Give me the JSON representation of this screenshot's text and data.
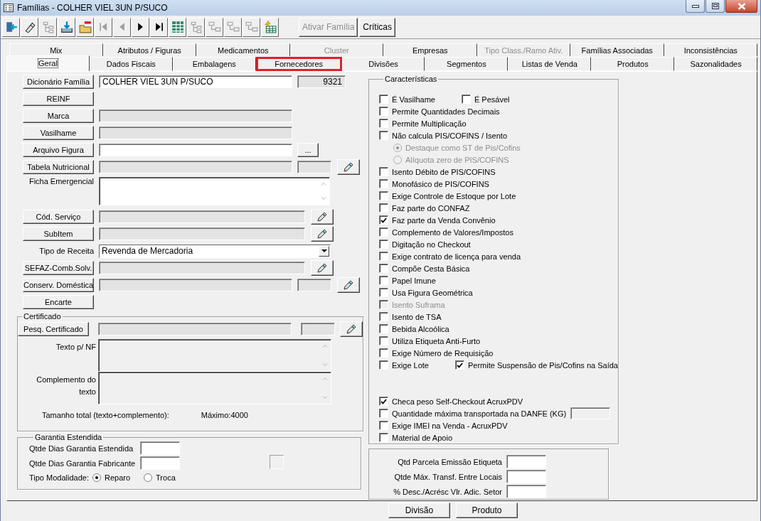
{
  "window": {
    "title": "Famílias - COLHER VIEL 3UN P/SUCO"
  },
  "toolbar": {
    "icons": [
      {
        "kind": "exit",
        "disabled": false
      },
      {
        "kind": "eraser",
        "disabled": false
      },
      {
        "kind": "tree",
        "disabled": true
      },
      {
        "kind": "import",
        "disabled": false
      },
      {
        "kind": "folder-remove",
        "disabled": false
      },
      {
        "kind": "first",
        "disabled": true
      },
      {
        "kind": "prev",
        "disabled": true
      },
      {
        "kind": "next",
        "disabled": false
      },
      {
        "kind": "last",
        "disabled": false
      },
      {
        "kind": "grid",
        "disabled": false
      },
      {
        "kind": "tree",
        "disabled": true
      },
      {
        "kind": "flow",
        "disabled": true
      },
      {
        "kind": "flow",
        "disabled": true
      },
      {
        "kind": "flow",
        "disabled": true
      },
      {
        "kind": "bolt-grid",
        "disabled": false
      }
    ],
    "buttons": [
      {
        "label": "Ativar Família",
        "disabled": true
      },
      {
        "label": "Críticas",
        "disabled": false
      }
    ]
  },
  "tabs_back": [
    {
      "label": "Mix",
      "disabled": false
    },
    {
      "label": "Atributos / Figuras",
      "disabled": false
    },
    {
      "label": "Medicamentos",
      "disabled": false
    },
    {
      "label": "Cluster",
      "disabled": true
    },
    {
      "label": "Empresas",
      "disabled": false
    },
    {
      "label": "Tipo Class./Ramo Ativ.",
      "disabled": true
    },
    {
      "label": "Famílias Associadas",
      "disabled": false
    },
    {
      "label": "Inconsistências",
      "disabled": false
    }
  ],
  "tabs_front": [
    {
      "label": "Geral",
      "selected": true,
      "highlighted": false
    },
    {
      "label": "Dados Fiscais",
      "selected": false,
      "highlighted": false
    },
    {
      "label": "Embalagens",
      "selected": false,
      "highlighted": false
    },
    {
      "label": "Fornecedores",
      "selected": false,
      "highlighted": true
    },
    {
      "label": "Divisões",
      "selected": false,
      "highlighted": false
    },
    {
      "label": "Segmentos",
      "selected": false,
      "highlighted": false
    },
    {
      "label": "Listas de Venda",
      "selected": false,
      "highlighted": false
    },
    {
      "label": "Produtos",
      "selected": false,
      "highlighted": false
    },
    {
      "label": "Sazonalidades",
      "selected": false,
      "highlighted": false
    }
  ],
  "general_rows": [
    {
      "kind": "lookup",
      "button": "Dicionário Família",
      "fields": [
        {
          "value": "COLHER VIEL 3UN P/SUCO",
          "editable": true
        },
        {
          "value": "9321",
          "editable": false
        }
      ]
    },
    {
      "kind": "button",
      "button": "REINF"
    },
    {
      "kind": "lookup",
      "button": "Marca",
      "fields": [
        {
          "editable": false
        }
      ]
    },
    {
      "kind": "lookup",
      "button": "Vasilhame",
      "fields": [
        {
          "editable": false
        }
      ]
    },
    {
      "kind": "lookup",
      "button": "Arquivo Figura",
      "fields": [
        {
          "editable": true
        }
      ],
      "action": {
        "kind": "browse",
        "label": "..."
      }
    },
    {
      "kind": "lookup",
      "button": "Tabela Nutricional",
      "fields": [
        {
          "editable": false
        },
        {
          "editable": false
        }
      ],
      "action": {
        "kind": "edit"
      }
    },
    {
      "kind": "memo",
      "label": "Ficha Emergencial",
      "editable": true
    },
    {
      "kind": "lookup",
      "button": "Cód. Serviço",
      "fields": [
        {
          "editable": false
        }
      ],
      "action": {
        "kind": "edit"
      }
    },
    {
      "kind": "lookup",
      "button": "SubItem",
      "fields": [
        {
          "editable": false
        }
      ],
      "action": {
        "kind": "edit"
      }
    },
    {
      "kind": "select",
      "label": "Tipo de Receita",
      "value": "Revenda de Mercadoria"
    },
    {
      "kind": "lookup",
      "button": "SEFAZ-Comb.Solv.",
      "fields": [
        {
          "editable": false
        }
      ],
      "action": {
        "kind": "edit"
      }
    },
    {
      "kind": "lookup",
      "button": "Conserv. Doméstica",
      "fields": [
        {
          "editable": false
        },
        {
          "editable": false
        }
      ],
      "action": {
        "kind": "edit"
      }
    },
    {
      "kind": "button",
      "button": "Encarte"
    }
  ],
  "certificate": {
    "title": "Certificado",
    "lookup": {
      "kind": "lookup",
      "button": "Pesq. Certificado",
      "fields": [
        {
          "editable": false
        },
        {
          "editable": false
        }
      ],
      "action": {
        "kind": "edit"
      }
    },
    "memos": [
      {
        "label": "Texto p/ NF",
        "editable": false
      },
      {
        "label": "Complemento do texto",
        "editable": false
      }
    ],
    "total_label": "Tamanho total (texto+complemento):",
    "max_label": "Máximo:4000"
  },
  "warranty": {
    "title": "Garantia Estendida",
    "fields": [
      {
        "label": "Qtde Dias Garantia Estendida"
      },
      {
        "label": "Qtde Dias Garantia Fabricante"
      }
    ],
    "modality": {
      "label": "Tipo Modalidade:",
      "options": [
        {
          "label": "Reparo",
          "selected": true
        },
        {
          "label": "Troca",
          "selected": false
        }
      ]
    }
  },
  "characteristics": {
    "title": "Características",
    "blocks": [
      {
        "rows": [
          {
            "items": [
              {
                "kind": "check",
                "label": "É Vasilhame",
                "checked": false,
                "disabled": false
              },
              {
                "kind": "check",
                "label": "É Pesável",
                "checked": false,
                "disabled": false
              }
            ]
          },
          {
            "items": [
              {
                "kind": "check",
                "label": "Permite Quantidades Decimais",
                "checked": false,
                "disabled": false
              }
            ]
          },
          {
            "items": [
              {
                "kind": "check",
                "label": "Permite Multiplicação",
                "checked": false,
                "disabled": false
              }
            ]
          },
          {
            "items": [
              {
                "kind": "check",
                "label": "Não calcula PIS/COFINS / Isento",
                "checked": false,
                "disabled": false
              }
            ]
          },
          {
            "items": [
              {
                "kind": "radio",
                "label": "Destaque como ST de Pis/Cofins",
                "selected": true,
                "disabled": true
              }
            ]
          },
          {
            "items": [
              {
                "kind": "radio",
                "label": "Alíquota zero de PIS/COFINS",
                "selected": false,
                "disabled": true
              }
            ]
          },
          {
            "items": [
              {
                "kind": "check",
                "label": "Isento Débito de PIS/COFINS",
                "checked": false,
                "disabled": false
              }
            ]
          },
          {
            "items": [
              {
                "kind": "check",
                "label": "Monofásico de PIS/COFINS",
                "checked": false,
                "disabled": false
              }
            ]
          },
          {
            "items": [
              {
                "kind": "check",
                "label": "Exige Controle de Estoque por Lote",
                "checked": false,
                "disabled": false
              }
            ]
          },
          {
            "items": [
              {
                "kind": "check",
                "label": "Faz parte do CONFAZ",
                "checked": false,
                "disabled": false
              }
            ]
          },
          {
            "items": [
              {
                "kind": "check",
                "label": "Faz parte da Venda Convênio",
                "checked": true,
                "disabled": false
              }
            ]
          },
          {
            "items": [
              {
                "kind": "check",
                "label": "Complemento de Valores/Impostos",
                "checked": false,
                "disabled": false
              }
            ]
          },
          {
            "items": [
              {
                "kind": "check",
                "label": "Digitação no Checkout",
                "checked": false,
                "disabled": false
              }
            ]
          },
          {
            "items": [
              {
                "kind": "check",
                "label": "Exige contrato de licença para venda",
                "checked": false,
                "disabled": false
              }
            ]
          },
          {
            "items": [
              {
                "kind": "check",
                "label": "Compõe Cesta Básica",
                "checked": false,
                "disabled": false
              }
            ]
          },
          {
            "items": [
              {
                "kind": "check",
                "label": "Papel Imune",
                "checked": false,
                "disabled": false
              }
            ]
          },
          {
            "items": [
              {
                "kind": "check",
                "label": "Usa Figura Geométrica",
                "checked": false,
                "disabled": false
              }
            ]
          },
          {
            "items": [
              {
                "kind": "check",
                "label": "Isento Suframa",
                "checked": false,
                "disabled": true
              }
            ]
          },
          {
            "items": [
              {
                "kind": "check",
                "label": "Isento de TSA",
                "checked": false,
                "disabled": false
              }
            ]
          },
          {
            "items": [
              {
                "kind": "check",
                "label": "Bebida Alcoólica",
                "checked": false,
                "disabled": false
              }
            ]
          },
          {
            "items": [
              {
                "kind": "check",
                "label": "Utiliza Etiqueta Anti-Furto",
                "checked": false,
                "disabled": false
              }
            ]
          },
          {
            "items": [
              {
                "kind": "check",
                "label": "Exige Número de Requisição",
                "checked": false,
                "disabled": false
              }
            ]
          },
          {
            "items": [
              {
                "kind": "check",
                "label": "Exige Lote",
                "checked": false,
                "disabled": false
              },
              {
                "kind": "check",
                "label": "Permite Suspensão de Pis/Cofins na Saída",
                "checked": true,
                "disabled": false
              }
            ]
          }
        ]
      },
      {
        "rows": [
          {
            "items": [
              {
                "kind": "check",
                "label": "Checa peso Self-Checkout AcruxPDV",
                "checked": true,
                "disabled": false
              }
            ]
          },
          {
            "items": [
              {
                "kind": "check_field",
                "label": "Quantidade máxima transportada na DANFE (KG)",
                "checked": false,
                "disabled": false
              }
            ]
          },
          {
            "items": [
              {
                "kind": "check",
                "label": "Exige IMEI na Venda - AcruxPDV",
                "checked": false,
                "disabled": false
              }
            ]
          },
          {
            "items": [
              {
                "kind": "check",
                "label": "Material de Apoio",
                "checked": false,
                "disabled": false
              }
            ]
          }
        ]
      }
    ]
  },
  "limits": {
    "fields": [
      {
        "label": "Qtd Parcela Emissão Etiqueta"
      },
      {
        "label": "Qtde Máx. Transf. Entre Locais"
      },
      {
        "label": "% Desc./Acrésc Vlr. Adic. Setor"
      }
    ]
  },
  "footer_buttons": [
    {
      "label": "Divisão"
    },
    {
      "label": "Produto"
    }
  ]
}
